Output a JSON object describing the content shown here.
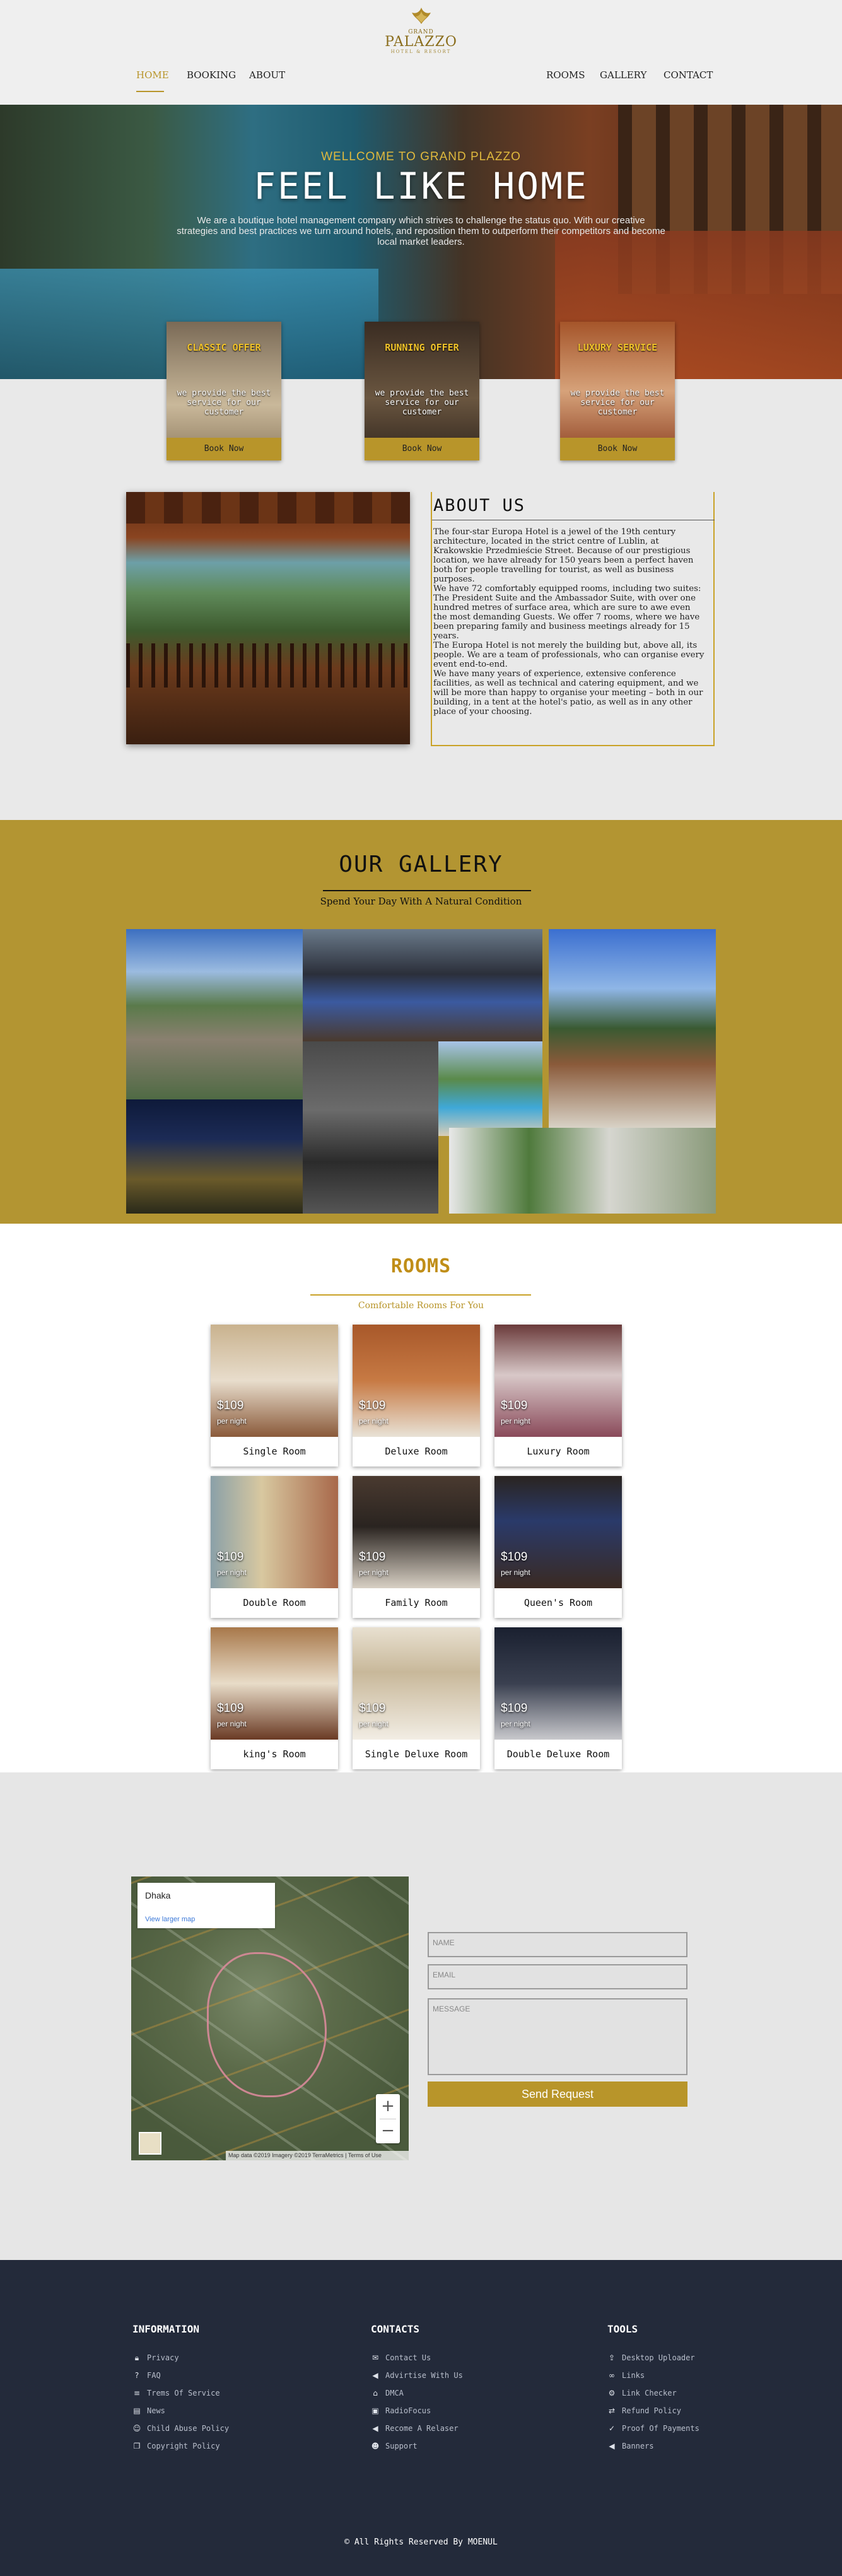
{
  "header": {
    "logo": {
      "small": "GRAND",
      "name": "PALAZZO",
      "tagline": "HOTEL & RESORT"
    },
    "nav_left": [
      "HOME",
      "BOOKING",
      "ABOUT"
    ],
    "nav_right": [
      "ROOMS",
      "GALLERY",
      "CONTACT"
    ],
    "active": "HOME",
    "accent": "#b8952a"
  },
  "hero": {
    "welcome": "WELLCOME TO GRAND PLAZZO",
    "title": "FEEL LIKE HOME",
    "text": "We are a boutique hotel management company which strives to challenge the status quo. With our creative strategies and best practices we turn around hotels, and reposition them to outperform their competitors and become local market leaders."
  },
  "offers": [
    {
      "title": "CLASSIC OFFER",
      "desc": "we provide the best service for our customer",
      "button": "Book Now"
    },
    {
      "title": "RUNNING OFFER",
      "desc": "we provide the best service for our customer",
      "button": "Book Now"
    },
    {
      "title": "LUXURY SERVICE",
      "desc": "we provide the best service for our customer",
      "button": "Book Now"
    }
  ],
  "about": {
    "title": "ABOUT US",
    "paragraphs": [
      "The four-star Europa Hotel is a jewel of the 19th century architecture, located in the strict centre of Lublin, at Krakowskie Przedmieście Street. Because of our prestigious location, we have already for 150 years been a perfect haven both for people travelling for tourist, as well as business purposes.",
      "We have 72 comfortably equipped rooms, including two suites: The President Suite and the Ambassador Suite, with over one hundred metres of surface area, which are sure to awe even the most demanding Guests. We offer 7 rooms, where we have been preparing family and business meetings already for 15 years.",
      "The Europa Hotel is not merely the building but, above all, its people. We are a team of professionals, who can organise every event end-to-end.",
      "We have many years of experience, extensive conference facilities, as well as technical and catering equipment, and we will be more than happy to organise your meeting – both in our building, in a tent at the hotel's patio, as well as in any other place of your choosing."
    ]
  },
  "gallery": {
    "title": "OUR GALLERY",
    "subtitle": "Spend Your Day With A Natural Condition"
  },
  "rooms": {
    "title": "ROOMS",
    "subtitle": "Comfortable Rooms For You",
    "per_night": "per night",
    "items": [
      {
        "name": "Single Room",
        "price": "$109"
      },
      {
        "name": "Deluxe Room",
        "price": "$109"
      },
      {
        "name": "Luxury Room",
        "price": "$109"
      },
      {
        "name": "Double Room",
        "price": "$109"
      },
      {
        "name": "Family Room",
        "price": "$109"
      },
      {
        "name": "Queen's Room",
        "price": "$109"
      },
      {
        "name": "king's Room",
        "price": "$109"
      },
      {
        "name": "Single Deluxe Room",
        "price": "$109"
      },
      {
        "name": "Double Deluxe Room",
        "price": "$109"
      }
    ]
  },
  "contact": {
    "map": {
      "place": "Dhaka",
      "link": "View larger map",
      "attribution": "Map data ©2019 Imagery ©2019 TerraMetrics | Terms of Use"
    },
    "name_placeholder": "NAME",
    "email_placeholder": "EMAIL",
    "message_placeholder": "MESSAGE",
    "send": "Send Request"
  },
  "footer": {
    "columns": [
      {
        "title": "INFORMATION",
        "items": [
          {
            "icon": "lock-icon",
            "label": "Privacy"
          },
          {
            "icon": "question-icon",
            "label": "FAQ"
          },
          {
            "icon": "list-icon",
            "label": "Trems Of Service"
          },
          {
            "icon": "newspaper-icon",
            "label": "News"
          },
          {
            "icon": "child-icon",
            "label": "Child Abuse Policy"
          },
          {
            "icon": "copy-icon",
            "label": "Copyright Policy"
          }
        ]
      },
      {
        "title": "CONTACTS",
        "items": [
          {
            "icon": "envelope-icon",
            "label": "Contact Us"
          },
          {
            "icon": "bullhorn-icon",
            "label": "Advirtise With Us"
          },
          {
            "icon": "bank-icon",
            "label": "DMCA"
          },
          {
            "icon": "radio-icon",
            "label": "RadioFocus"
          },
          {
            "icon": "megaphone-icon",
            "label": "Recome A Relaser"
          },
          {
            "icon": "user-headset-icon",
            "label": "Support"
          }
        ]
      },
      {
        "title": "TOOLS",
        "items": [
          {
            "icon": "upload-icon",
            "label": "Desktop Uploader"
          },
          {
            "icon": "link-icon",
            "label": "Links"
          },
          {
            "icon": "gear-icon",
            "label": "Link Checker"
          },
          {
            "icon": "refund-icon",
            "label": "Refund Policy"
          },
          {
            "icon": "thumb-icon",
            "label": "Proof Of Payments"
          },
          {
            "icon": "bullhorn-icon",
            "label": "Banners"
          }
        ]
      }
    ],
    "copyright": "© All Rights Reserved By MOENUL"
  }
}
